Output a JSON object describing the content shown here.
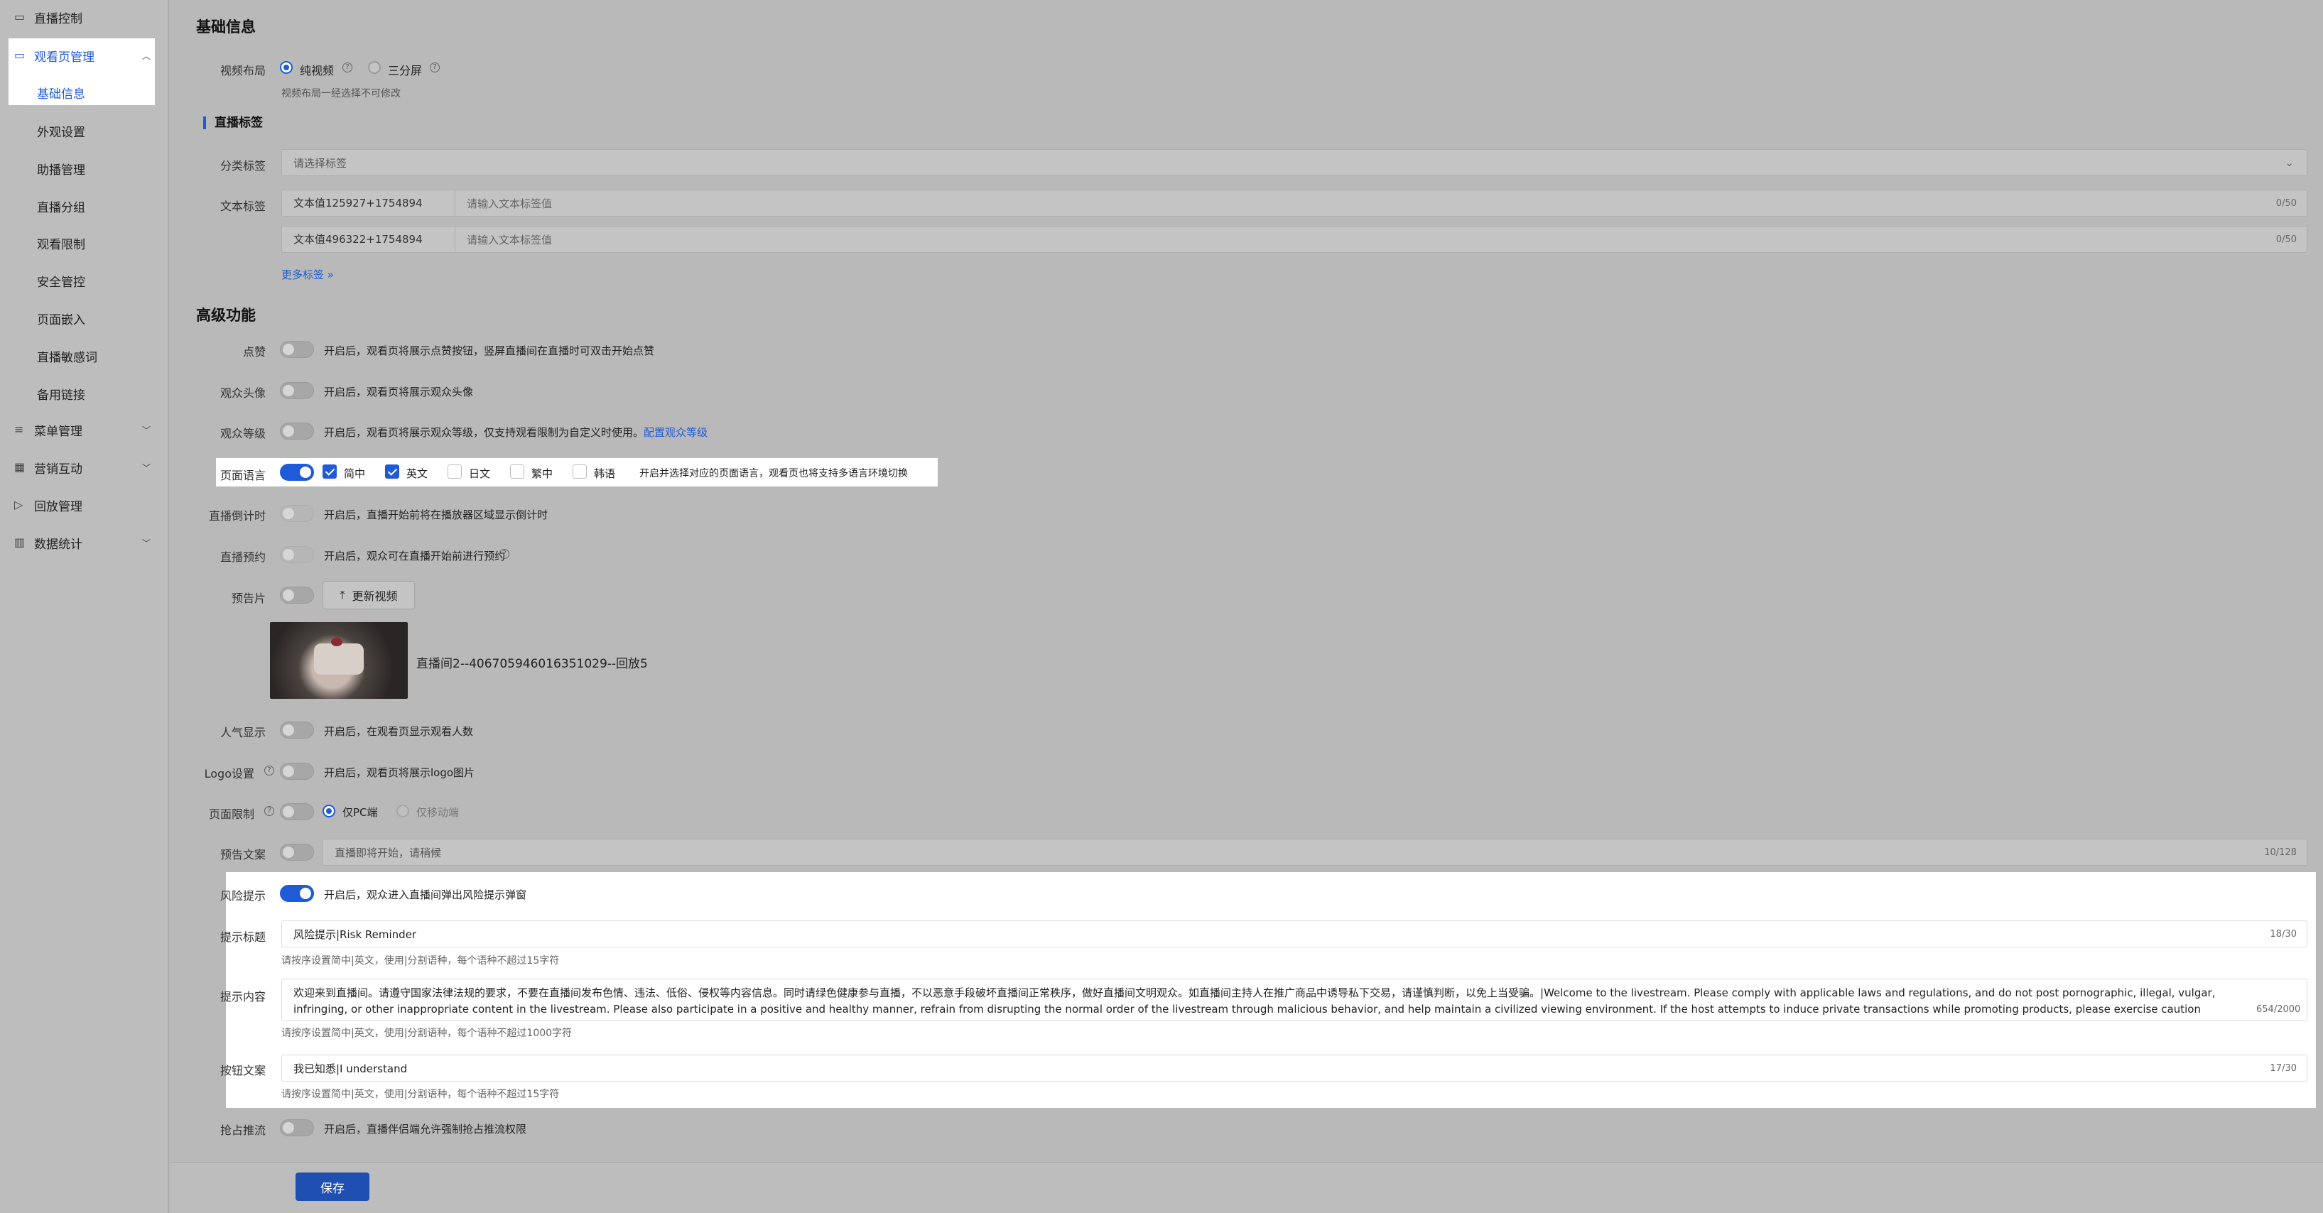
{
  "sidebar": {
    "items": [
      {
        "label": "直播控制",
        "icon": "live-control-icon"
      },
      {
        "label": "观看页管理",
        "icon": "watch-page-icon"
      },
      {
        "label": "菜单管理",
        "icon": "menu-icon"
      },
      {
        "label": "营销互动",
        "icon": "marketing-icon"
      },
      {
        "label": "回放管理",
        "icon": "replay-icon"
      },
      {
        "label": "数据统计",
        "icon": "stats-icon"
      }
    ],
    "sub_items": [
      "基础信息",
      "外观设置",
      "助播管理",
      "直播分组",
      "观看限制",
      "安全管控",
      "页面嵌入",
      "直播敏感词",
      "备用链接"
    ]
  },
  "basic": {
    "title": "基础信息",
    "video_layout_label": "视频布局",
    "layout_option_1": "纯视频",
    "layout_option_2": "三分屏",
    "layout_hint": "视频布局一经选择不可修改"
  },
  "tags": {
    "title": "直播标签",
    "category_label": "分类标签",
    "category_placeholder": "请选择标签",
    "text_label": "文本标签",
    "rows": [
      {
        "key": "文本值125927+1754894",
        "placeholder": "请输入文本标签值",
        "count": "0/50"
      },
      {
        "key": "文本值496322+1754894",
        "placeholder": "请输入文本标签值",
        "count": "0/50"
      }
    ],
    "more": "更多标签"
  },
  "advanced": {
    "title": "高级功能",
    "like_label": "点赞",
    "like_desc": "开启后，观看页将展示点赞按钮，竖屏直播间在直播时可双击开始点赞",
    "avatar_label": "观众头像",
    "avatar_desc": "开启后，观看页将展示观众头像",
    "level_label": "观众等级",
    "level_desc": "开启后，观看页将展示观众等级，仅支持观看限制为自定义时使用。",
    "level_link": "配置观众等级",
    "lang_label": "页面语言",
    "lang_options": [
      "简中",
      "英文",
      "日文",
      "繁中",
      "韩语"
    ],
    "lang_desc": "开启并选择对应的页面语言，观看页也将支持多语言环境切换",
    "countdown_label": "直播倒计时",
    "countdown_desc": "开启后，直播开始前将在播放器区域显示倒计时",
    "reserve_label": "直播预约",
    "reserve_desc": "开启后，观众可在直播开始前进行预约",
    "trailer_label": "预告片",
    "update_video": "更新视频",
    "video_name": "直播间2--406705946016351029--回放5",
    "popularity_label": "人气显示",
    "popularity_desc": "开启后，在观看页显示观看人数",
    "logo_label": "Logo设置",
    "logo_desc": "开启后，观看页将展示logo图片",
    "page_limit_label": "页面限制",
    "page_limit_opt1": "仅PC端",
    "page_limit_opt2": "仅移动端",
    "preview_text_label": "预告文案",
    "preview_text_value": "直播即将开始，请稍候",
    "preview_text_count": "10/128",
    "risk_label": "风险提示",
    "risk_desc": "开启后，观众进入直播间弹出风险提示弹窗",
    "risk_title_label": "提示标题",
    "risk_title_value": "风险提示|Risk Reminder",
    "risk_title_count": "18/30",
    "risk_title_hint": "请按序设置简中|英文，使用|分割语种，每个语种不超过15字符",
    "risk_content_label": "提示内容",
    "risk_content_value": "欢迎来到直播间。请遵守国家法律法规的要求，不要在直播间发布色情、违法、低俗、侵权等内容信息。同时请绿色健康参与直播，不以恶意手段破坏直播间正常秩序，做好直播间文明观众。如直播间主持人在推广商品中诱导私下交易，请谨慎判断，以免上当受骗。|Welcome to the livestream. Please comply with applicable laws and regulations, and do not post pornographic, illegal, vulgar, infringing, or other inappropriate content in the livestream. Please also participate in a positive and healthy manner, refrain from disrupting the normal order of the livestream through malicious behavior, and help maintain a civilized viewing environment. If the host attempts to induce private transactions while promoting products, please exercise caution and make careful judgments to avoid being scammed.",
    "risk_content_count": "654/2000",
    "risk_content_hint": "请按序设置简中|英文，使用|分割语种，每个语种不超过1000字符",
    "button_text_label": "按钮文案",
    "button_text_value": "我已知悉|I understand",
    "button_text_count": "17/30",
    "button_text_hint": "请按序设置简中|英文，使用|分割语种，每个语种不超过15字符",
    "grab_label": "抢占推流",
    "grab_desc": "开启后，直播伴侣端允许强制抢占推流权限"
  },
  "footer": {
    "save": "保存"
  },
  "colors": {
    "accent": "#1f5bd6",
    "overlay": "#b9b9b9"
  }
}
